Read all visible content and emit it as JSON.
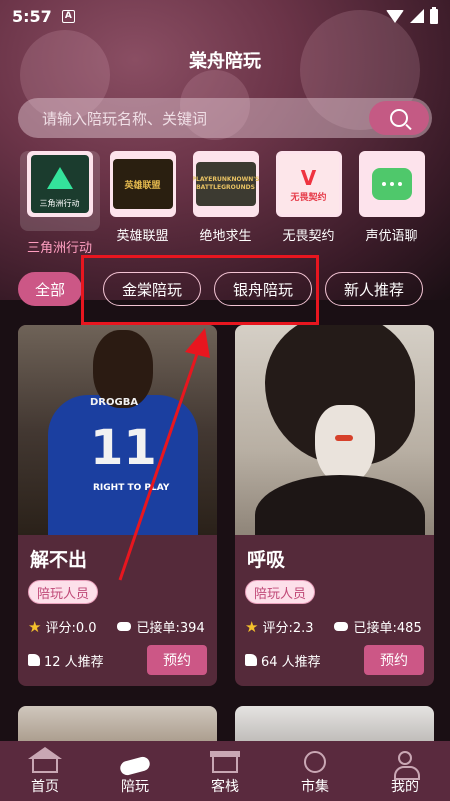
{
  "status_bar": {
    "time": "5:57",
    "notification_glyph": "A"
  },
  "app": {
    "title": "棠舟陪玩"
  },
  "search": {
    "placeholder": "请输入陪玩名称、关键词"
  },
  "games": [
    {
      "label": "三角洲行动",
      "icon": "delta-force-icon",
      "selected": true,
      "tile_text": "三角洲行动"
    },
    {
      "label": "英雄联盟",
      "icon": "league-of-legends-icon",
      "selected": false,
      "tile_text": "英雄联盟"
    },
    {
      "label": "绝地求生",
      "icon": "pubg-icon",
      "selected": false,
      "tile_text": "PLAYERUNKNOWN'S BATTLEGROUNDS"
    },
    {
      "label": "无畏契约",
      "icon": "valorant-icon",
      "selected": false,
      "tile_text": "无畏契约"
    },
    {
      "label": "声优语聊",
      "icon": "voice-chat-icon",
      "selected": false
    }
  ],
  "filters": [
    {
      "label": "全部",
      "active": true
    },
    {
      "label": "金棠陪玩",
      "active": false
    },
    {
      "label": "银舟陪玩",
      "active": false
    },
    {
      "label": "新人推荐",
      "active": false
    }
  ],
  "cards": [
    {
      "name": "解不出",
      "tag": "陪玩人员",
      "rating": "评分:0.0",
      "orders": "已接单:394",
      "recommend": "12 人推荐",
      "book_label": "预约",
      "jersey_name": "DROGBA",
      "jersey_number": "11",
      "sponsor": "RIGHT TO PLAY"
    },
    {
      "name": "呼吸",
      "tag": "陪玩人员",
      "rating": "评分:2.3",
      "orders": "已接单:485",
      "recommend": "64 人推荐",
      "book_label": "预约"
    }
  ],
  "nav": [
    {
      "label": "首页",
      "icon": "home-icon",
      "active": false
    },
    {
      "label": "陪玩",
      "icon": "handshake-icon",
      "active": true
    },
    {
      "label": "客栈",
      "icon": "inn-icon",
      "active": false
    },
    {
      "label": "市集",
      "icon": "market-icon",
      "active": false
    },
    {
      "label": "我的",
      "icon": "profile-icon",
      "active": false
    }
  ],
  "colors": {
    "accent": "#cc5786",
    "annotation": "#e8161f",
    "highlight_text": "#ff9ec0"
  }
}
